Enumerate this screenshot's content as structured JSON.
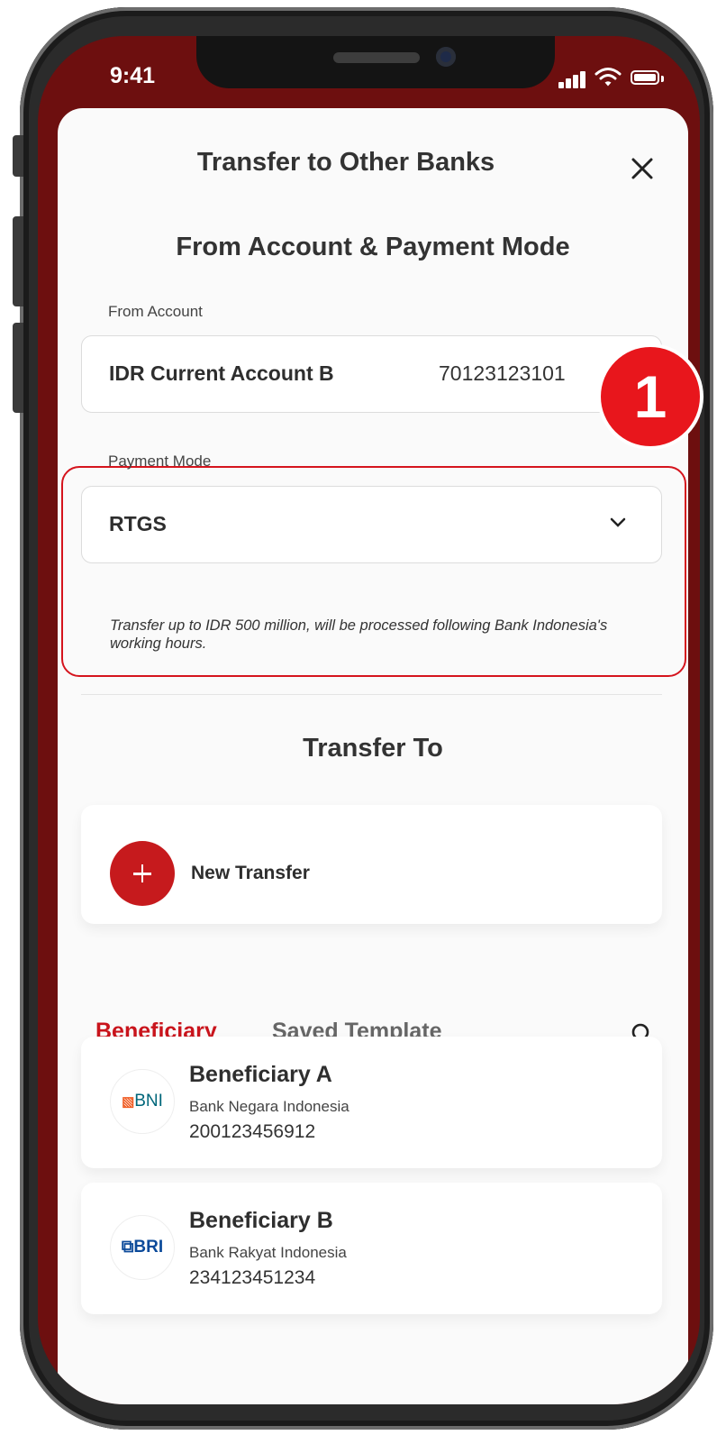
{
  "status_bar": {
    "time": "9:41"
  },
  "header": {
    "title": "Transfer to Other Banks"
  },
  "from_section": {
    "title": "From Account & Payment Mode",
    "from_account_label": "From Account",
    "from_account_name": "IDR Current Account B",
    "from_account_number": "70123123101",
    "payment_mode_label": "Payment Mode",
    "payment_mode_value": "RTGS",
    "payment_mode_note": "Transfer up to IDR 500 million, will be processed following Bank Indonesia's working hours."
  },
  "annotation": {
    "badge": "1",
    "accent": "#e8161c"
  },
  "transfer_to": {
    "title": "Transfer To",
    "new_transfer_label": "New Transfer"
  },
  "tabs": [
    {
      "label": "Beneficiary",
      "active": true
    },
    {
      "label": "Saved Template",
      "active": false
    }
  ],
  "beneficiaries": [
    {
      "logo": "BNI",
      "name": "Beneficiary A",
      "bank": "Bank Negara Indonesia",
      "account": "200123456912"
    },
    {
      "logo": "BRI",
      "name": "Beneficiary B",
      "bank": "Bank Rakyat Indonesia",
      "account": "234123451234"
    }
  ],
  "colors": {
    "brand_red": "#c9141c",
    "header_bg": "#6d0f0f"
  }
}
